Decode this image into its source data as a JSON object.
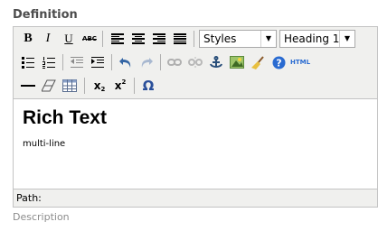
{
  "field": {
    "label": "Definition",
    "description": "Description"
  },
  "toolbar": {
    "bold": "B",
    "italic": "I",
    "underline": "U",
    "strikethrough": "ABC",
    "styles_select": "Styles",
    "format_select": "Heading 1",
    "html": "HTML",
    "subscript_label": "x",
    "subscript_mark": "2",
    "superscript_label": "x",
    "superscript_mark": "2",
    "charmap": "Ω"
  },
  "content": {
    "heading": "Rich Text",
    "paragraph": "multi-line"
  },
  "statusbar": {
    "path_label": "Path:"
  },
  "colors": {
    "toolbar_bg": "#f0f0ee",
    "border": "#c3c3c3",
    "help_blue": "#2a6bd1",
    "undo_blue": "#3465a4"
  }
}
